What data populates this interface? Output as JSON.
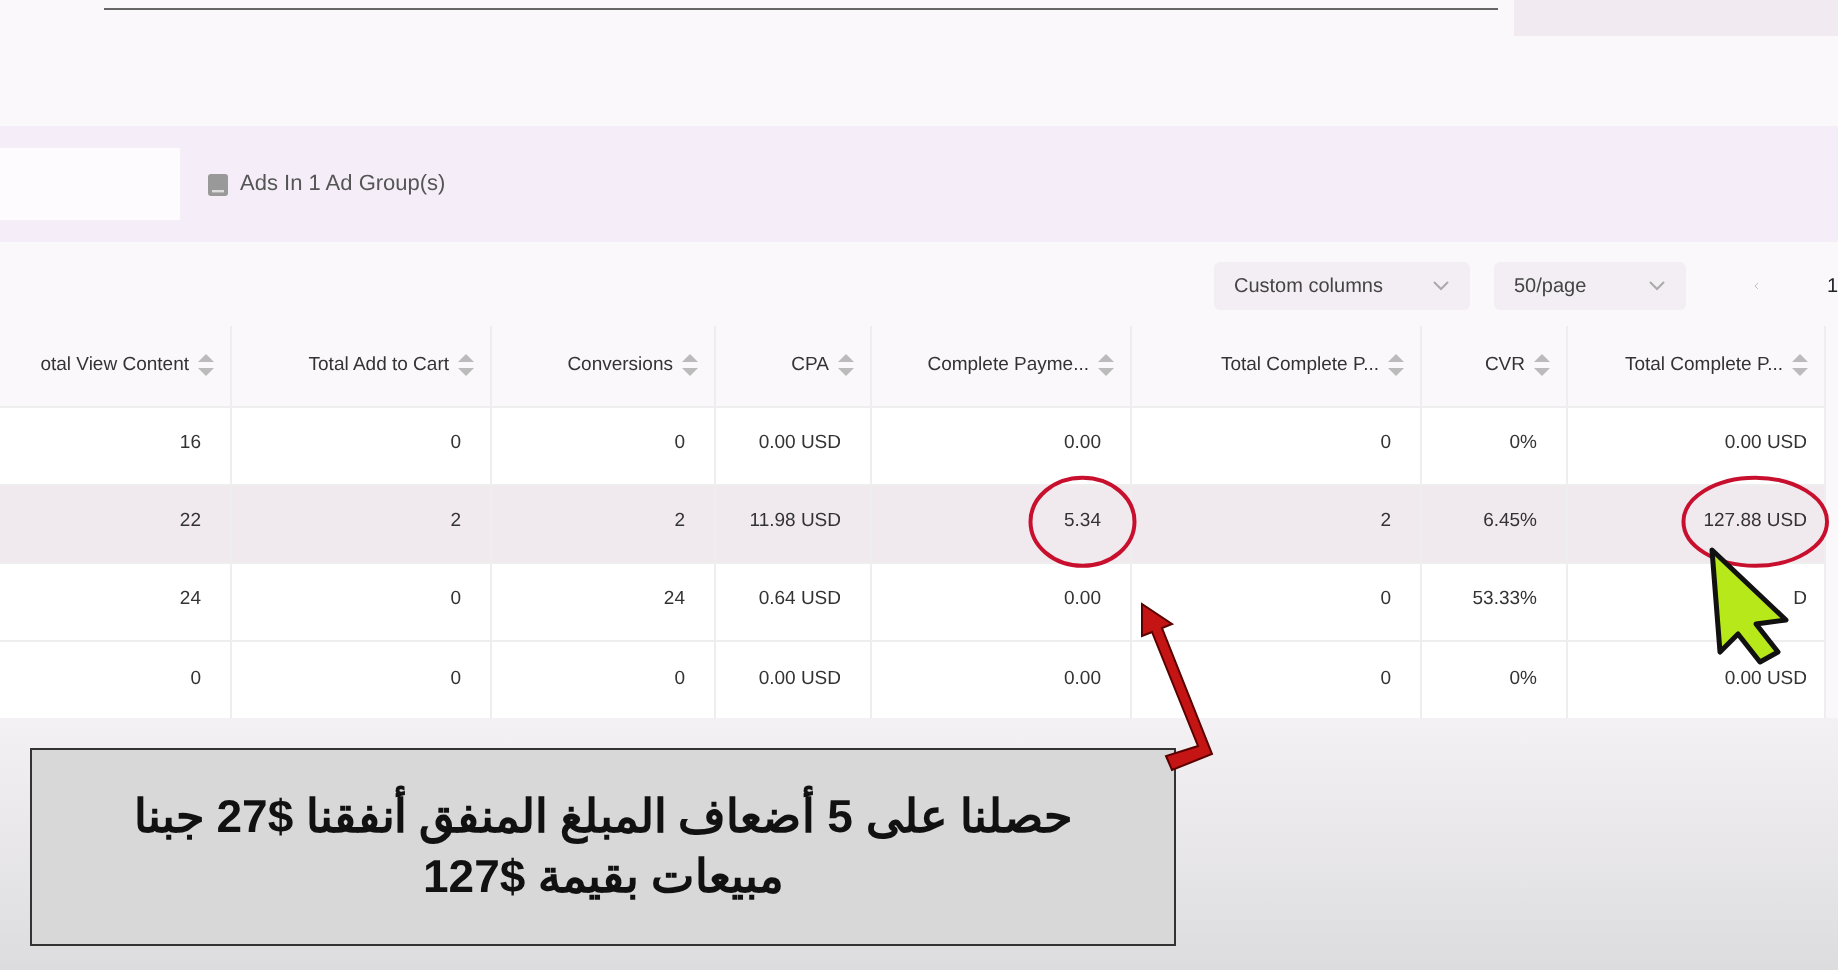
{
  "ad_tab": {
    "label": "Ads In 1 Ad Group(s)"
  },
  "toolbar": {
    "custom_columns": "Custom columns",
    "page_size": "50/page",
    "page": "1"
  },
  "table": {
    "columns": [
      "otal View Content",
      "Total Add to Cart",
      "Conversions",
      "CPA",
      "Complete Payme...",
      "Total Complete P...",
      "CVR",
      "Total Complete P..."
    ],
    "rows": [
      {
        "highlighted": false,
        "circled": [
          false,
          false,
          false,
          false,
          false,
          false,
          false,
          false
        ],
        "cells": [
          "16",
          "0",
          "0",
          "0.00 USD",
          "0.00",
          "0",
          "0%",
          "0.00 USD"
        ]
      },
      {
        "highlighted": true,
        "circled": [
          false,
          false,
          false,
          false,
          true,
          false,
          false,
          true
        ],
        "cells": [
          "22",
          "2",
          "2",
          "11.98 USD",
          "5.34",
          "2",
          "6.45%",
          "127.88 USD"
        ]
      },
      {
        "highlighted": false,
        "circled": [
          false,
          false,
          false,
          false,
          false,
          false,
          false,
          false
        ],
        "cells": [
          "24",
          "0",
          "24",
          "0.64 USD",
          "0.00",
          "0",
          "53.33%",
          "D"
        ]
      },
      {
        "highlighted": false,
        "circled": [
          false,
          false,
          false,
          false,
          false,
          false,
          false,
          false
        ],
        "cells": [
          "0",
          "0",
          "0",
          "0.00 USD",
          "0.00",
          "0",
          "0%",
          "0.00 USD"
        ]
      }
    ]
  },
  "caption": "حصلنا على 5 أضعاف المبلغ المنفق أنفقنا $27 جبنا مبيعات بقيمة $127"
}
